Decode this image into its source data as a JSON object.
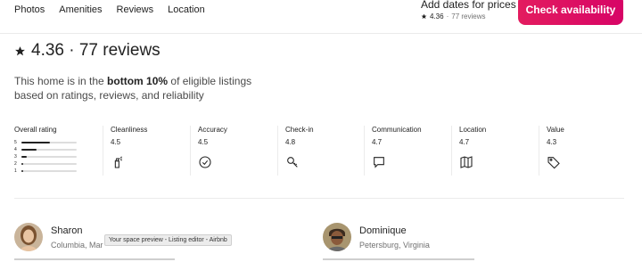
{
  "nav": {
    "links": [
      "Photos",
      "Amenities",
      "Reviews",
      "Location"
    ]
  },
  "booking": {
    "price_prompt": "Add dates for prices",
    "rating": "4.36",
    "separator": "·",
    "reviews": "77 reviews",
    "button_label": "Check availability"
  },
  "summary": {
    "heading": "4.36 · 77 reviews",
    "desc_pre": "This home is in the ",
    "desc_bold": "bottom 10%",
    "desc_post": " of eligible listings based on ratings, reviews, and reliability"
  },
  "overall": {
    "label": "Overall rating",
    "rows": [
      {
        "star": "5",
        "fill": 0.52
      },
      {
        "star": "4",
        "fill": 0.28
      },
      {
        "star": "3",
        "fill": 0.1
      },
      {
        "star": "2",
        "fill": 0.03
      },
      {
        "star": "1",
        "fill": 0.03
      }
    ]
  },
  "categories": [
    {
      "label": "Cleanliness",
      "value": "4.5",
      "icon": "spray-bottle-icon"
    },
    {
      "label": "Accuracy",
      "value": "4.5",
      "icon": "check-circle-icon"
    },
    {
      "label": "Check-in",
      "value": "4.8",
      "icon": "key-icon"
    },
    {
      "label": "Communication",
      "value": "4.7",
      "icon": "message-icon"
    },
    {
      "label": "Location",
      "value": "4.7",
      "icon": "map-icon"
    },
    {
      "label": "Value",
      "value": "4.3",
      "icon": "tag-icon"
    }
  ],
  "reviews": [
    {
      "name": "Sharon",
      "location": "Columbia, Mar"
    },
    {
      "name": "Dominique",
      "location": "Petersburg, Virginia"
    }
  ],
  "tooltip": "Your space preview - Listing editor - Airbnb",
  "colors": {
    "accent": "#e31c5f",
    "text": "#222222",
    "muted": "#717171"
  }
}
